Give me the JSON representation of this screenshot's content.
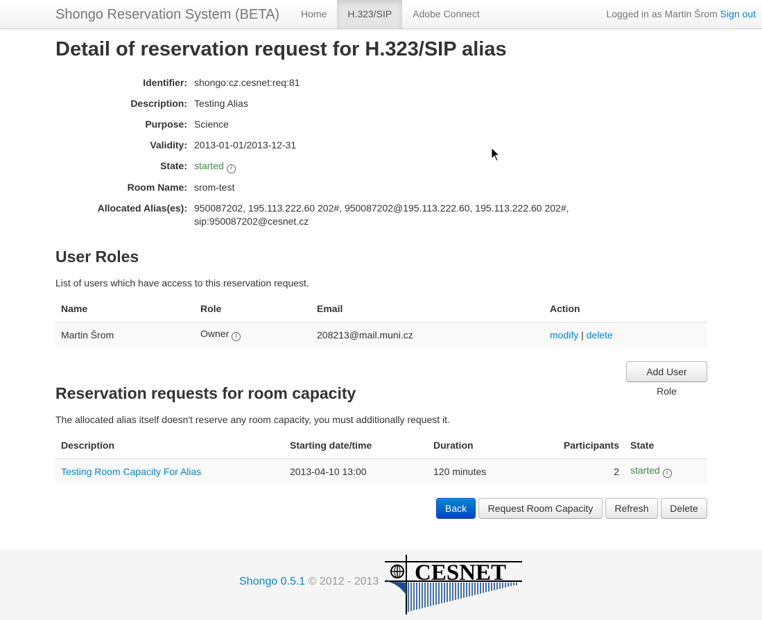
{
  "navbar": {
    "brand": "Shongo Reservation System (BETA)",
    "items": [
      {
        "label": "Home",
        "active": false
      },
      {
        "label": "H.323/SIP",
        "active": true
      },
      {
        "label": "Adobe Connect",
        "active": false
      }
    ],
    "logged_in_text": "Logged in as Martin Šrom",
    "sign_out": "Sign out"
  },
  "page_title": "Detail of reservation request for H.323/SIP alias",
  "details": {
    "identifier_label": "Identifier:",
    "identifier": "shongo:cz.cesnet:req:81",
    "description_label": "Description:",
    "description": "Testing Alias",
    "purpose_label": "Purpose:",
    "purpose": "Science",
    "validity_label": "Validity:",
    "validity": "2013-01-01/2013-12-31",
    "state_label": "State:",
    "state": "started",
    "room_name_label": "Room Name:",
    "room_name": "srom-test",
    "aliases_label": "Allocated Alias(es):",
    "aliases_line1": "950087202, 195.113.222.60 202#, 950087202@195.113.222.60, 195.113.222.60 202#,",
    "aliases_line2": "sip:950087202@cesnet.cz"
  },
  "user_roles": {
    "heading": "User Roles",
    "description": "List of users which have access to this reservation request.",
    "columns": [
      "Name",
      "Role",
      "Email",
      "Action"
    ],
    "rows": [
      {
        "name": "Martin Šrom",
        "role": "Owner",
        "email": "208213@mail.muni.cz",
        "modify": "modify",
        "separator": "|",
        "delete": "delete"
      }
    ],
    "add_button": "Add User Role"
  },
  "capacity": {
    "heading": "Reservation requests for room capacity",
    "description": "The allocated alias itself doesn't reserve any room capacity, you must additionally request it.",
    "columns": [
      "Description",
      "Starting date/time",
      "Duration",
      "Participants",
      "State"
    ],
    "rows": [
      {
        "description": "Testing Room Capacity For Alias",
        "start": "2013-04-10 13:00",
        "duration": "120 minutes",
        "participants": "2",
        "state": "started"
      }
    ]
  },
  "actions": {
    "back": "Back",
    "request_capacity": "Request Room Capacity",
    "refresh": "Refresh",
    "delete": "Delete"
  },
  "footer": {
    "version_link": "Shongo 0.5.1",
    "copyright": "© 2012 - 2013",
    "logo_text": "CESNET"
  },
  "colors": {
    "link": "#0088cc",
    "started": "#468847",
    "primary": "#0044cc"
  },
  "icons": {
    "info": "info-icon",
    "cursor": "mouse-cursor-icon"
  }
}
